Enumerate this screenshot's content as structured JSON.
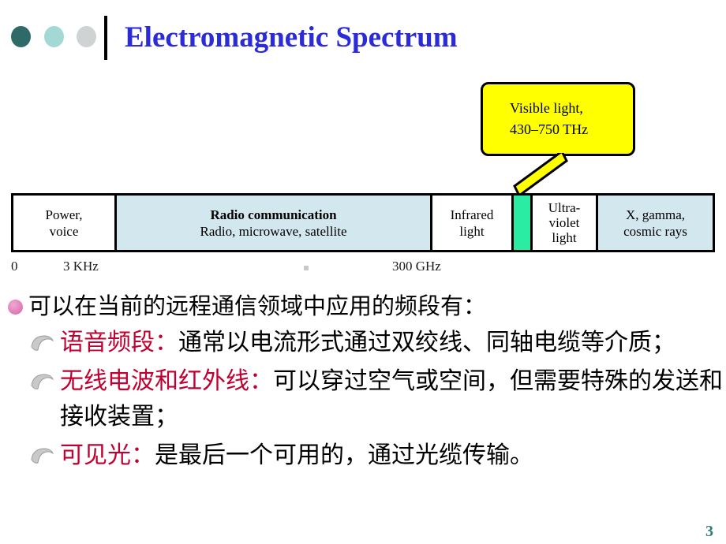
{
  "slide": {
    "title": "Electromagnetic Spectrum",
    "page_number": "3",
    "accent_colors": {
      "title_blue": "#2b2bd8",
      "dot_dark_teal": "#2e6b68",
      "dot_light_teal": "#a3d8d5",
      "dot_gray": "#cfd3d3",
      "callout_yellow": "#ffff00",
      "visible_green": "#2aeca3",
      "band_blue": "#d3e7ee",
      "heading_red": "#c00030",
      "bullet_pink": "#e183bb",
      "page_number_teal": "#2e7d7a"
    }
  },
  "callout": {
    "line1": "Visible light,",
    "line2": "430–750 THz",
    "text": "Visible light,\n430–750 THz"
  },
  "spectrum": {
    "bands": [
      {
        "id": "power",
        "line1": "Power,",
        "line2": "voice",
        "line3": ""
      },
      {
        "id": "radio",
        "line1": "Radio communication",
        "line2": "Radio, microwave, satellite",
        "line3": ""
      },
      {
        "id": "infrared",
        "line1": "Infrared",
        "line2": "light",
        "line3": ""
      },
      {
        "id": "visible",
        "line1": "",
        "line2": "",
        "line3": ""
      },
      {
        "id": "ultraviolet",
        "line1": "Ultra-",
        "line2": "violet",
        "line3": "light"
      },
      {
        "id": "xray",
        "line1": "X, gamma,",
        "line2": "cosmic rays",
        "line3": ""
      }
    ],
    "axis": {
      "start": "0",
      "tick_3khz": "3 KHz",
      "tick_300ghz": "300 GHz"
    }
  },
  "body": {
    "lead": "可以在当前的远程通信领域中应用的频段有：",
    "items": [
      {
        "head": "语音频段：",
        "rest": "通常以电流形式通过双绞线、同轴电缆等介质；"
      },
      {
        "head": "无线电波和红外线：",
        "rest": "可以穿过空气或空间，但需要特殊的发送和接收装置；"
      },
      {
        "head": "可见光：",
        "rest": "是最后一个可用的，通过光缆传输。"
      }
    ]
  }
}
